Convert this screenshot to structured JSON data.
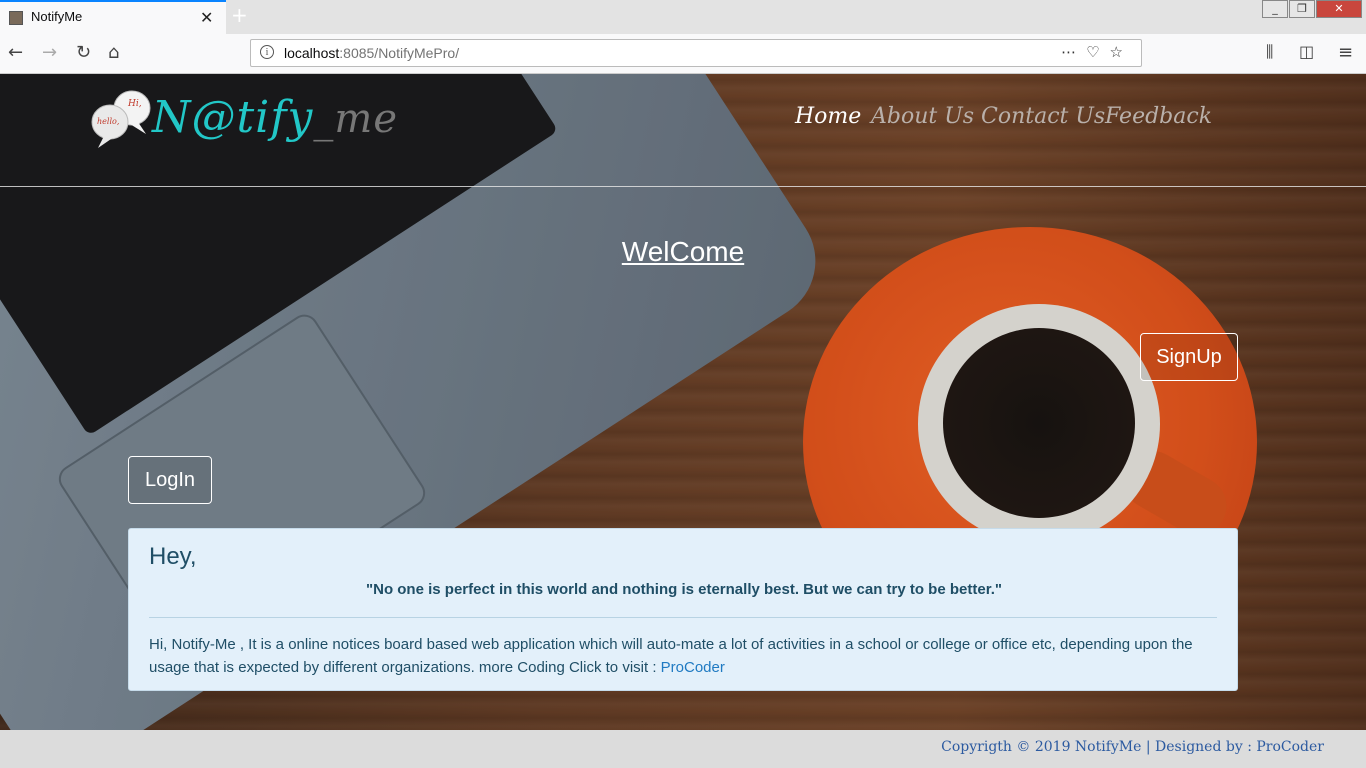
{
  "browser": {
    "tab_title": "NotifyMe",
    "new_tab": "+",
    "tab_close": "✕",
    "url_host": "localhost",
    "url_rest": ":8085/NotifyMePro/",
    "url_info_icon": "i"
  },
  "header": {
    "logo_text": "N@tify",
    "logo_sep": "_",
    "logo_me": "me",
    "bubble_hi": "Hi,",
    "bubble_hello": "hello,",
    "nav": [
      "Home",
      "About Us",
      "Contact Us",
      "Feedback"
    ]
  },
  "hero": {
    "welcome": "WelCome",
    "signup": "SignUp",
    "login": "LogIn"
  },
  "card": {
    "title": "Hey,",
    "quote": "\"No one is perfect in this world and nothing is eternally best. But we can try to be better.\"",
    "body": "Hi, Notify-Me , It is a online notices board based web application which will auto-mate a lot of activities in a school or college or office etc, depending upon the usage that is expected by different organizations. more Coding Click to visit : ",
    "link": "ProCoder"
  },
  "footer": {
    "text": "Copyrigth © 2019 NotifyMe | Designed by : ",
    "link": "ProCoder"
  },
  "colors": {
    "logo_teal": "#22c7c7",
    "card_bg": "#e3f0fa",
    "link": "#1f7ac2",
    "footer_link": "#2c5aa0"
  }
}
